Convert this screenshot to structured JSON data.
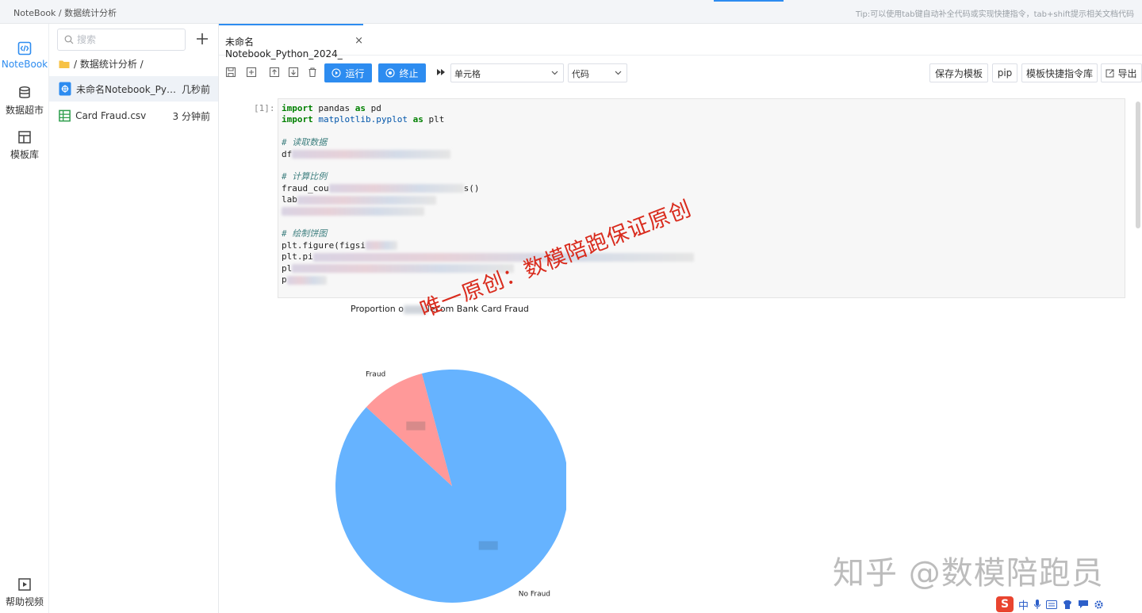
{
  "topbar": {
    "breadcrumb": "NoteBook / 数据统计分析",
    "tip": "Tip:可以使用tab键自动补全代码或实现快捷指令，tab+shift提示相关文档代码"
  },
  "nav": {
    "items": [
      {
        "label": "NoteBook",
        "icon": "code-icon",
        "active": true
      },
      {
        "label": "数据超市",
        "icon": "database-icon",
        "active": false
      },
      {
        "label": "模板库",
        "icon": "template-icon",
        "active": false
      }
    ],
    "help_label": "帮助视频"
  },
  "files": {
    "search_placeholder": "搜索",
    "folder_path": "/ 数据统计分析 /",
    "items": [
      {
        "name": "未命名Notebook_Python...",
        "time": "几秒前",
        "type": "notebook"
      },
      {
        "name": "Card Fraud.csv",
        "time": "3 分钟前",
        "type": "csv"
      }
    ]
  },
  "tab": {
    "label": "未命名Notebook_Python_2024_",
    "close_glyph": "×"
  },
  "toolbar": {
    "run_label": "运行",
    "stop_label": "终止",
    "cell_type_select": "单元格",
    "mode_select": "代码",
    "save_template": "保存为模板",
    "pip": "pip",
    "template_shortcuts": "模板快捷指令库",
    "export": "导出"
  },
  "cell": {
    "prompt": "[1]:",
    "comment_read": "# 读取数据",
    "comment_ratio": "# 计算比例",
    "comment_plot": "# 绘制饼图"
  },
  "chart_data": {
    "type": "pie",
    "title_visible_prefix": "Proportion o",
    "title_visible_suffix": "lecom Bank Card Fraud",
    "labels": [
      "Fraud",
      "No Fraud"
    ],
    "values": [
      0.09,
      0.91
    ],
    "colors": [
      "#ff9999",
      "#66b3ff"
    ],
    "start_angle_deg": 105
  },
  "watermarks": {
    "red": "唯一原创：数模陪跑保证原创",
    "zhihu": "知乎 @数模陪跑员"
  },
  "taskbar": {
    "ime_logo": "S",
    "ime_lang": "中"
  }
}
